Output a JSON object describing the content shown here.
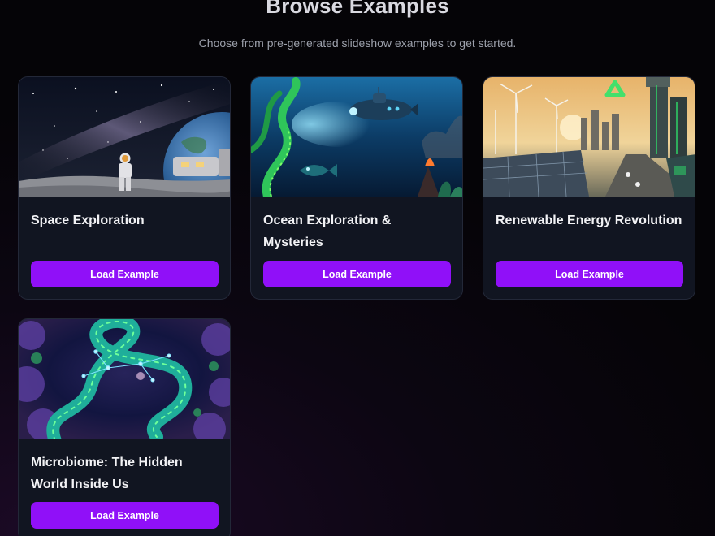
{
  "header": {
    "title": "Browse Examples",
    "subtitle": "Choose from pre-generated slideshow examples to get started."
  },
  "examples": [
    {
      "title": "Space Exploration",
      "button_label": "Load Example",
      "image": "astronaut-on-moon-with-earth"
    },
    {
      "title": "Ocean Exploration & Mysteries",
      "button_label": "Load Example",
      "image": "submarine-underwater-with-tentacles"
    },
    {
      "title": "Renewable Energy Revolution",
      "button_label": "Load Example",
      "image": "solar-panels-wind-turbines-city"
    },
    {
      "title": "Microbiome: The Hidden World Inside Us",
      "button_label": "Load Example",
      "image": "microbes-constellation"
    }
  ],
  "colors": {
    "accent": "#9010f8",
    "card_background": "#111521",
    "page_background": "#07060b"
  }
}
